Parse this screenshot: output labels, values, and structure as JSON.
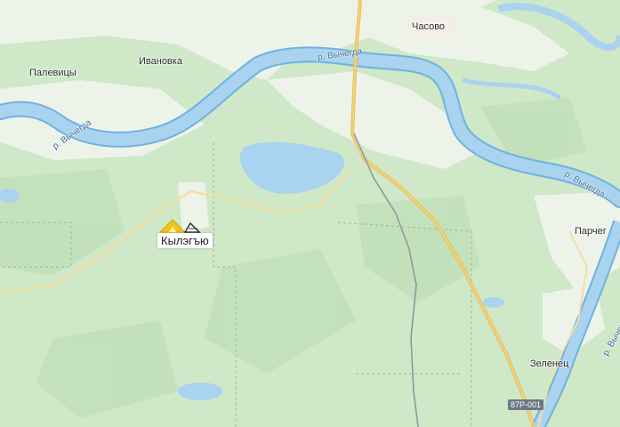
{
  "map": {
    "settlements": [
      {
        "id": "palevitsy",
        "name": "Палевицы"
      },
      {
        "id": "ivanovka",
        "name": "Ивановка"
      },
      {
        "id": "chasovo",
        "name": "Часово"
      },
      {
        "id": "parcheg",
        "name": "Парчег"
      },
      {
        "id": "zelenets",
        "name": "Зеленец"
      }
    ],
    "river_labels": [
      "р. Вычегда",
      "р. Вычегда",
      "р. Вычегда",
      "р. Вычегда"
    ],
    "selected_place": {
      "name": "Кылэгъю",
      "icon": "camping-tent-icon"
    },
    "road_shield": "87Р-001",
    "colors": {
      "forest": "#cfe8c8",
      "open_land": "#eef3ea",
      "water": "#a9d3ef",
      "river_outline": "#6fb2e0",
      "road": "#f3d27a",
      "railway": "#8d949a",
      "pin_accent": "#f5c518"
    }
  }
}
